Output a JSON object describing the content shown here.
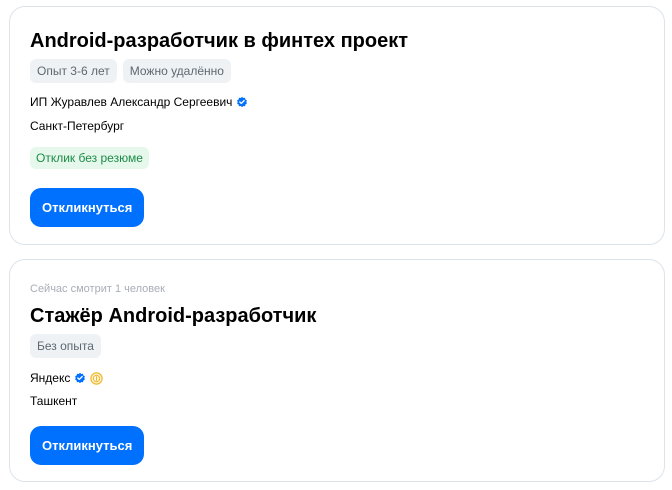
{
  "vacancies": [
    {
      "viewing": "",
      "title": "Android-разработчик в финтех проект",
      "tags": [
        "Опыт 3-6 лет",
        "Можно удалённо"
      ],
      "company": "ИП Журавлев Александр Сергеевич",
      "company_icons": [
        "verified-check-icon"
      ],
      "city": "Санкт-Петербург",
      "badge": "Отклик без резюме",
      "respond_label": "Откликнуться"
    },
    {
      "viewing": "Сейчас смотрит 1 человек",
      "title": "Стажёр Android-разработчик",
      "tags": [
        "Без опыта"
      ],
      "company": "Яндекс",
      "company_icons": [
        "verified-check-icon",
        "coin-icon"
      ],
      "city": "Ташкент",
      "badge": "",
      "respond_label": "Откликнуться"
    }
  ],
  "colors": {
    "accent": "#0070ff",
    "verified": "#0070ff",
    "tag_bg": "#eff2f5",
    "badge_green_bg": "#e6f7ec",
    "badge_green_text": "#1c8c45",
    "coin": "#f2b728"
  }
}
